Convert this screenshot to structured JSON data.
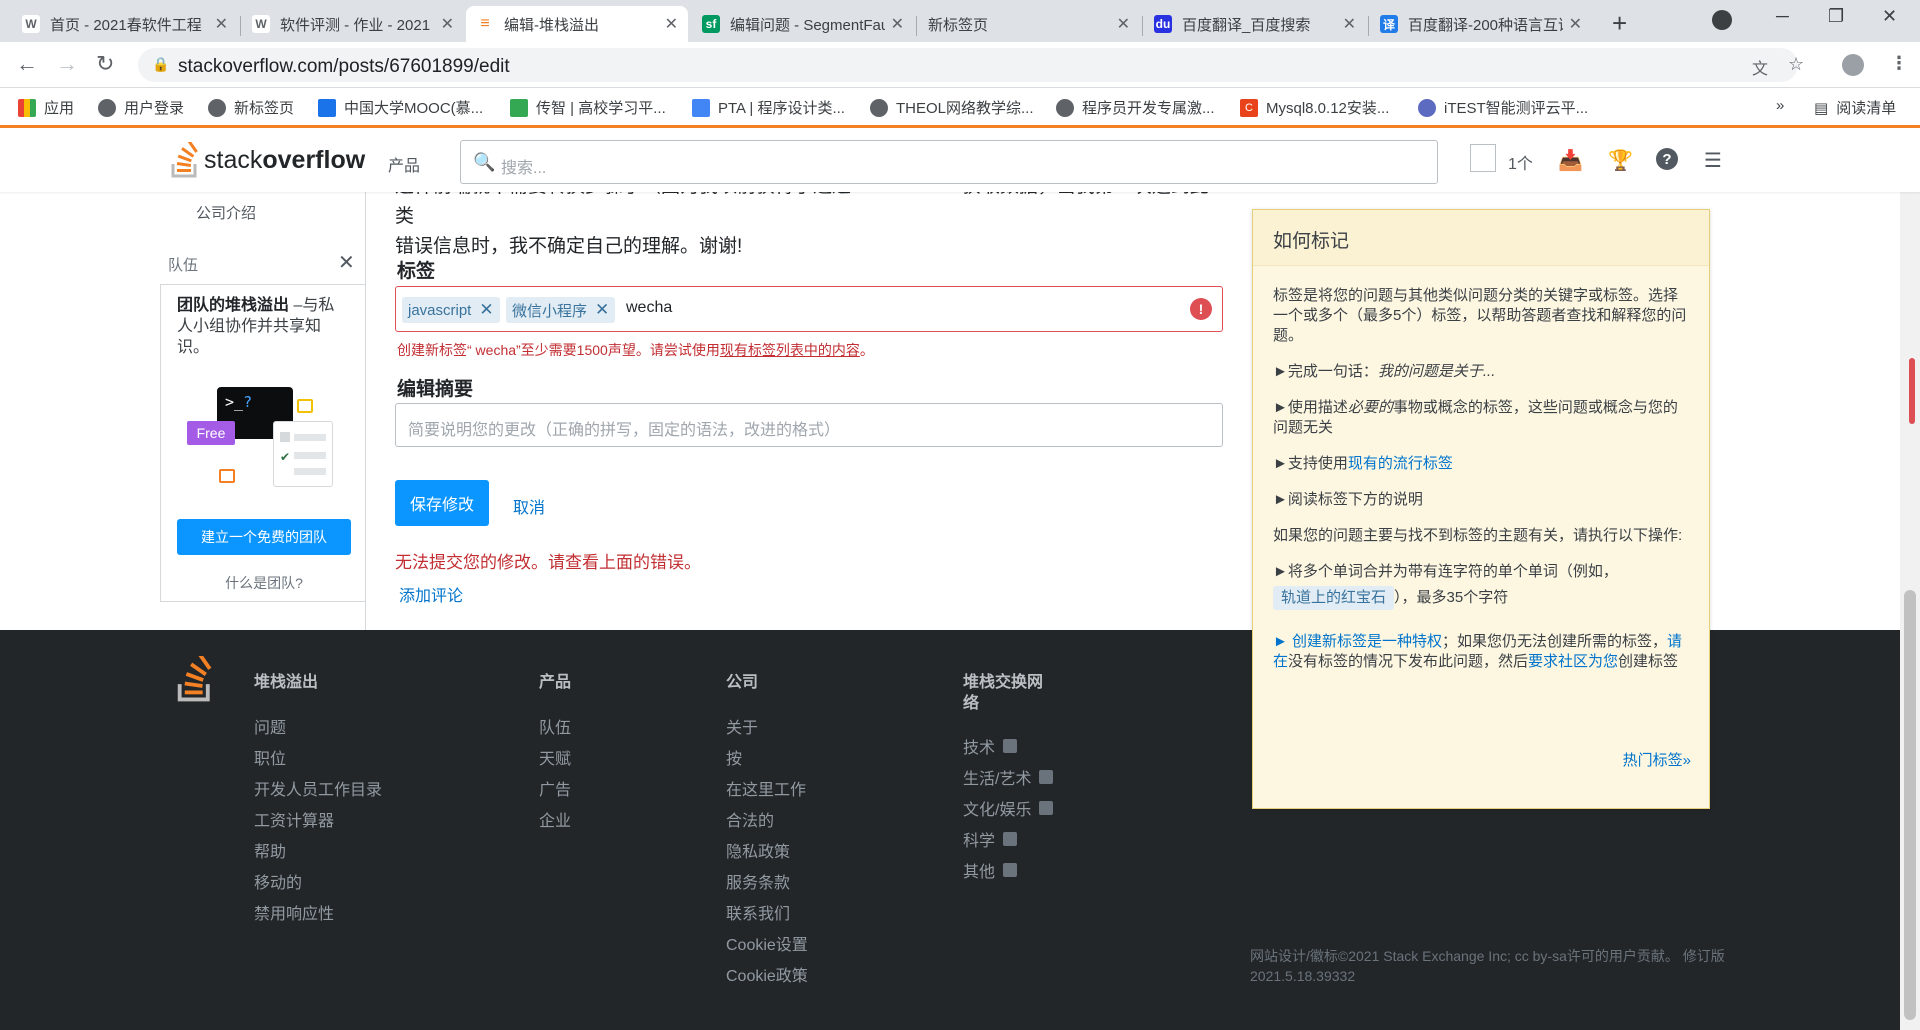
{
  "browser": {
    "tabs": [
      {
        "title": "首页 - 2021春软件工程",
        "icon_text": "W",
        "icon_color": "#5f6368"
      },
      {
        "title": "软件评测 - 作业 - 2021",
        "icon_text": "W",
        "icon_color": "#5f6368"
      },
      {
        "title": "编辑-堆栈溢出",
        "icon_text": "≡",
        "icon_color": "#f48024"
      },
      {
        "title": "编辑问题 - SegmentFault",
        "icon_text": "sf",
        "icon_color": "#009a61"
      },
      {
        "title": "新标签页",
        "icon_text": "",
        "icon_color": "#dee1e6"
      },
      {
        "title": "百度翻译_百度搜索",
        "icon_text": "du",
        "icon_color": "#2932e1"
      },
      {
        "title": "百度翻译-200种语言互译",
        "icon_text": "译",
        "icon_color": "#1f7ce8"
      }
    ],
    "url": "stackoverflow.com/posts/67601899/edit",
    "bookmarks": [
      {
        "label": "应用",
        "icon_color": "#ea4335"
      },
      {
        "label": "用户登录",
        "icon_color": "#5f6368"
      },
      {
        "label": "新标签页",
        "icon_color": "#5f6368"
      },
      {
        "label": "中国大学MOOC(慕...",
        "icon_color": "#1a73e8"
      },
      {
        "label": "传智 | 高校学习平...",
        "icon_color": "#34a853"
      },
      {
        "label": "PTA | 程序设计类...",
        "icon_color": "#4285f4"
      },
      {
        "label": "THEOL网络教学综...",
        "icon_color": "#5f6368"
      },
      {
        "label": "程序员开发专属激...",
        "icon_color": "#5f6368"
      },
      {
        "label": "Mysql8.0.12安装...",
        "icon_color": "#e8431a"
      },
      {
        "label": "iTEST智能测评云平...",
        "icon_color": "#5c6bc0"
      }
    ],
    "bookmarks_more": "»",
    "reading_list": "阅读清单"
  },
  "header": {
    "logo_plain": "stack",
    "logo_bold": "overflow",
    "products": "产品",
    "search_placeholder": "搜索...",
    "inbox_count": "1个"
  },
  "sidebar": {
    "company": "公司介绍",
    "teams_label": "队伍",
    "team_title": "团队的堆栈溢出",
    "team_desc": " –与私人小组协作并共享知识。",
    "free_badge": "Free",
    "create_team": "建立一个免费的团队",
    "what_is_team": "什么是团队?"
  },
  "main": {
    "body_line1": "这样前端就不需要转换步骤了（因为我以前获得了通过res.data.data获取数据，当我第一次遇到此类",
    "body_line2": "错误信息时，我不确定自己的理解。谢谢!",
    "tags_label": "标签",
    "tags": [
      "javascript",
      "微信小程序"
    ],
    "tag_typed": "wecha",
    "tag_error_prefix": "创建新标签“ wecha”至少需要1500声望。请尝试使用",
    "tag_error_link": "现有标签列表中的内容",
    "tag_error_suffix": "。",
    "summary_label": "编辑摘要",
    "summary_placeholder": "简要说明您的更改（正确的拼写，固定的语法，改进的格式）",
    "save_button": "保存修改",
    "cancel": "取消",
    "submit_error": "无法提交您的修改。请查看上面的错误。",
    "add_comment": "添加评论"
  },
  "help": {
    "title": "如何标记",
    "intro": "标签是将您的问题与其他类似问题分类的关键字或标签。选择一个或多个（最多5个）标签，以帮助答题者查找和解释您的问题。",
    "b1_prefix": "►完成一句话：",
    "b1_italic": "我的问题是关于...",
    "b2_prefix": "►使用描述",
    "b2_italic": "必要的",
    "b2_suffix": "事物或概念的标签，这些问题或概念与您的问题无关",
    "b3_prefix": "►支持使用",
    "b3_link": "现有的流行标签",
    "b4": "►阅读标签下方的说明",
    "p_unrelated": "如果您的问题主要与找不到标签的主题有关，请执行以下操作:",
    "b5_prefix": "►将多个单词合并为带有连字符的单个单词（例如，",
    "b5_tag": "轨道上的红宝石",
    "b5_suffix": "），最多35个字符",
    "b6_arrow": "► ",
    "b6_link1": "创建新标签是一种特权",
    "b6_mid1": "；如果您仍无法创建所需的标签，",
    "b6_link2": "请在",
    "b6_mid2": "没有标签的情况下发布此问题，然后",
    "b6_link3": "要求社区为您",
    "b6_end": "创建标签",
    "more": "热门标签»"
  },
  "footer": {
    "col1_title": "堆栈溢出",
    "col1": [
      "问题",
      "职位",
      "开发人员工作目录",
      "工资计算器",
      "帮助",
      "移动的",
      "禁用响应性"
    ],
    "col2_title": "产品",
    "col2": [
      "队伍",
      "天赋",
      "广告",
      "企业"
    ],
    "col3_title": "公司",
    "col3": [
      "关于",
      "按",
      "在这里工作",
      "合法的",
      "隐私政策",
      "服务条款",
      "联系我们",
      "Cookie设置",
      "Cookie政策"
    ],
    "col4_title": "堆栈交换网络",
    "col4": [
      "技术",
      "生活/艺术",
      "文化/娱乐",
      "科学",
      "其他"
    ],
    "copyright": "网站设计/徽标©2021 Stack Exchange Inc; cc by-sa许可的用户贡献。 修订版2021.5.18.39332"
  },
  "colors": {
    "accent": "#f48024",
    "primary_button": "#0a95ff",
    "error": "#c22e32",
    "tag_bg": "#e1ecf4"
  }
}
